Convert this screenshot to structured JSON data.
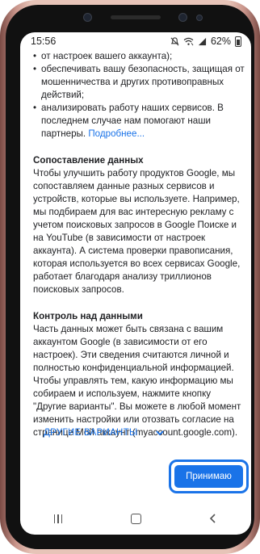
{
  "status": {
    "time": "15:56",
    "battery": "62%"
  },
  "content": {
    "bullets": [
      "от настроек вашего аккаунта);",
      "обеспечивать вашу безопасность, защищая от мошенничества и других противоправных действий;",
      "анализировать работу наших сервисов. В последнем случае нам помогают наши партнеры."
    ],
    "bullet_link": "Подробнее...",
    "section1_title": "Сопоставление данных",
    "section1_text": "Чтобы улучшить работу продуктов Google, мы сопоставляем данные разных сервисов и устройств, которые вы используете. Например, мы подбираем для вас интересную рекламу с учетом поисковых запросов в Google Поиске и на YouTube (в зависимости от настроек аккаунта). А система проверки правописания, которая используется во всех сервисах Google, работает благодаря анализу триллионов поисковых запросов.",
    "section2_title": "Контроль над данными",
    "section2_text": "Часть данных может быть связана с вашим аккаунтом Google (в зависимости от его настроек). Эти сведения считаются личной и полностью конфиденциальной информацией. Чтобы управлять тем, какую информацию мы собираем и используем, нажмите кнопку \"Другие варианты\". Вы можете в любой момент изменить настройки или отозвать согласие на странице Мой аккаунт (myaccount.google.com)."
  },
  "actions": {
    "more_options": "ДРУГИЕ ВАРИАНТЫ",
    "accept": "Принимаю"
  },
  "colors": {
    "accent": "#1a73e8"
  }
}
